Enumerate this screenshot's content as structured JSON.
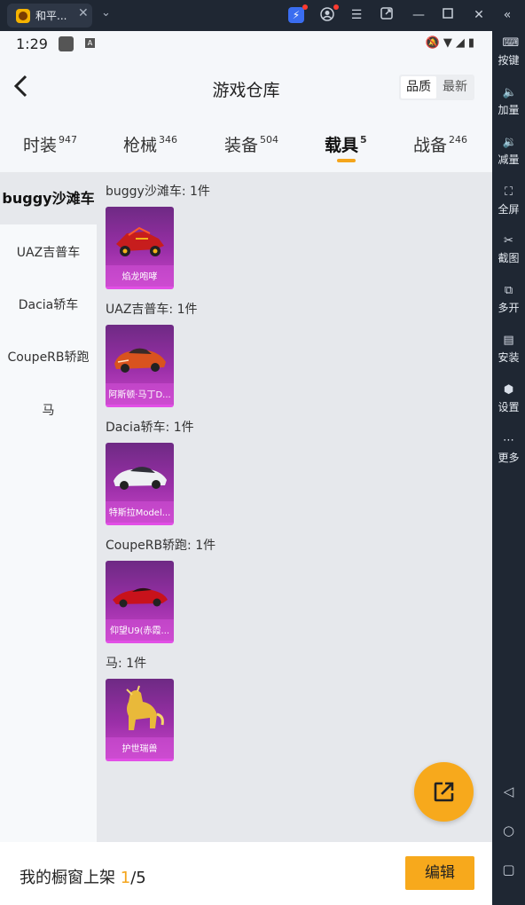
{
  "window": {
    "tab_title": "和平...",
    "tab_close": "✕",
    "dropdown": "⌄"
  },
  "status_bar": {
    "time": "1:29"
  },
  "header": {
    "title": "游戏仓库",
    "sort_options": [
      "品质",
      "最新"
    ]
  },
  "categories": [
    {
      "label": "时装",
      "count": "947"
    },
    {
      "label": "枪械",
      "count": "346"
    },
    {
      "label": "装备",
      "count": "504"
    },
    {
      "label": "载具",
      "count": "5"
    },
    {
      "label": "战备",
      "count": "246"
    }
  ],
  "sidenav": [
    "buggy沙滩车",
    "UAZ吉普车",
    "Dacia轿车",
    "CoupeRB轿跑",
    "马"
  ],
  "groups": [
    {
      "label": "buggy沙滩车: 1件",
      "item": "焰龙咆哮",
      "icon": "buggy-icon"
    },
    {
      "label": "UAZ吉普车: 1件",
      "item": "阿斯顿·马丁D...",
      "icon": "orange-car-icon"
    },
    {
      "label": "Dacia轿车: 1件",
      "item": "特斯拉Model...",
      "icon": "white-car-icon"
    },
    {
      "label": "CoupeRB轿跑: 1件",
      "item": "仰望U9(赤霞...",
      "icon": "red-car-icon"
    },
    {
      "label": "马: 1件",
      "item": "护世瑞兽",
      "icon": "golden-horse-icon"
    }
  ],
  "bottom_bar": {
    "label": "我的橱窗上架 ",
    "current": "1",
    "total": "/5",
    "edit_label": "编辑"
  },
  "right_sidebar": [
    "按键",
    "加量",
    "减量",
    "全屏",
    "截图",
    "多开",
    "安装",
    "设置",
    "更多"
  ],
  "colors": {
    "accent": "#f7a91c",
    "card_purple": "#9b2fa8"
  }
}
